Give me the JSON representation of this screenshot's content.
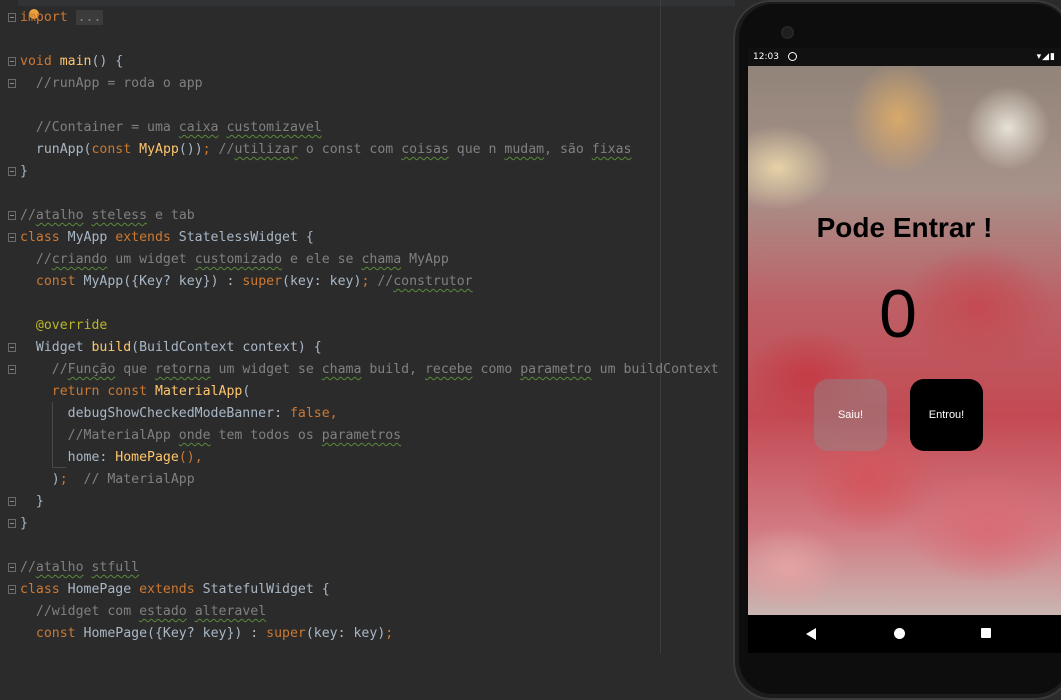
{
  "editor": {
    "lines": [
      {
        "parts": [
          {
            "t": "import",
            "c": "k"
          },
          {
            "t": " "
          },
          {
            "t": "...",
            "c": "dots"
          }
        ]
      },
      {
        "parts": []
      },
      {
        "parts": [
          {
            "t": "void",
            "c": "k"
          },
          {
            "t": " "
          },
          {
            "t": "main",
            "c": "f"
          },
          {
            "t": "() {"
          }
        ]
      },
      {
        "parts": [
          {
            "t": "  //runApp = roda o app",
            "c": "c"
          }
        ]
      },
      {
        "parts": []
      },
      {
        "parts": [
          {
            "t": "  //Container = uma ",
            "c": "c"
          },
          {
            "t": "caixa",
            "c": "c u"
          },
          {
            "t": " ",
            "c": "c"
          },
          {
            "t": "customizavel",
            "c": "c u"
          }
        ]
      },
      {
        "parts": [
          {
            "t": "  runApp("
          },
          {
            "t": "const",
            "c": "k"
          },
          {
            "t": " "
          },
          {
            "t": "MyApp",
            "c": "f"
          },
          {
            "t": "())"
          },
          {
            "t": ";",
            "c": "k"
          },
          {
            "t": " //",
            "c": "c"
          },
          {
            "t": "utilizar",
            "c": "c u"
          },
          {
            "t": " o const com ",
            "c": "c"
          },
          {
            "t": "coisas",
            "c": "c u"
          },
          {
            "t": " que n ",
            "c": "c"
          },
          {
            "t": "mudam",
            "c": "c u"
          },
          {
            "t": ", são ",
            "c": "c"
          },
          {
            "t": "fixas",
            "c": "c u"
          }
        ]
      },
      {
        "parts": [
          {
            "t": "}"
          }
        ]
      },
      {
        "parts": []
      },
      {
        "parts": [
          {
            "t": "//",
            "c": "c"
          },
          {
            "t": "atalho",
            "c": "c u"
          },
          {
            "t": " ",
            "c": "c"
          },
          {
            "t": "steless",
            "c": "c u"
          },
          {
            "t": " e tab",
            "c": "c"
          }
        ]
      },
      {
        "parts": [
          {
            "t": "class",
            "c": "k"
          },
          {
            "t": " MyApp "
          },
          {
            "t": "extends",
            "c": "k"
          },
          {
            "t": " StatelessWidget {"
          }
        ]
      },
      {
        "parts": [
          {
            "t": "  //",
            "c": "c"
          },
          {
            "t": "criando",
            "c": "c u"
          },
          {
            "t": " um widget ",
            "c": "c"
          },
          {
            "t": "customizado",
            "c": "c u"
          },
          {
            "t": " e ele se ",
            "c": "c"
          },
          {
            "t": "chama",
            "c": "c u"
          },
          {
            "t": " MyApp",
            "c": "c"
          }
        ]
      },
      {
        "parts": [
          {
            "t": "  "
          },
          {
            "t": "const",
            "c": "k"
          },
          {
            "t": " MyApp({Key? key}) : "
          },
          {
            "t": "super",
            "c": "k"
          },
          {
            "t": "(key: key)"
          },
          {
            "t": ";",
            "c": "k"
          },
          {
            "t": " //",
            "c": "c"
          },
          {
            "t": "construtor",
            "c": "c u"
          }
        ]
      },
      {
        "parts": []
      },
      {
        "parts": [
          {
            "t": "  "
          },
          {
            "t": "@override",
            "c": "a"
          }
        ]
      },
      {
        "parts": [
          {
            "t": "  Widget "
          },
          {
            "t": "build",
            "c": "f"
          },
          {
            "t": "(BuildContext context) {"
          }
        ]
      },
      {
        "parts": [
          {
            "t": "    //",
            "c": "c"
          },
          {
            "t": "Função",
            "c": "c u"
          },
          {
            "t": " que ",
            "c": "c"
          },
          {
            "t": "retorna",
            "c": "c u"
          },
          {
            "t": " um widget se ",
            "c": "c"
          },
          {
            "t": "chama",
            "c": "c u"
          },
          {
            "t": " build, ",
            "c": "c"
          },
          {
            "t": "recebe",
            "c": "c u"
          },
          {
            "t": " como ",
            "c": "c"
          },
          {
            "t": "parametro",
            "c": "c u"
          },
          {
            "t": " um buildContext",
            "c": "c"
          }
        ]
      },
      {
        "parts": [
          {
            "t": "    "
          },
          {
            "t": "return",
            "c": "k"
          },
          {
            "t": " "
          },
          {
            "t": "const",
            "c": "k"
          },
          {
            "t": " "
          },
          {
            "t": "MaterialApp",
            "c": "f"
          },
          {
            "t": "("
          }
        ]
      },
      {
        "parts": [
          {
            "t": "      debugShowCheckedModeBanner: "
          },
          {
            "t": "false,",
            "c": "k"
          }
        ]
      },
      {
        "parts": [
          {
            "t": "      //MaterialApp ",
            "c": "c"
          },
          {
            "t": "onde",
            "c": "c u"
          },
          {
            "t": " tem todos os ",
            "c": "c"
          },
          {
            "t": "parametros",
            "c": "c u"
          }
        ]
      },
      {
        "parts": [
          {
            "t": "      home: "
          },
          {
            "t": "HomePage",
            "c": "f"
          },
          {
            "t": "(),",
            "c": "k"
          }
        ]
      },
      {
        "parts": [
          {
            "t": "    )"
          },
          {
            "t": ";",
            "c": "k"
          },
          {
            "t": "  // MaterialApp",
            "c": "c"
          }
        ]
      },
      {
        "parts": [
          {
            "t": "  }"
          }
        ]
      },
      {
        "parts": [
          {
            "t": "}"
          }
        ]
      },
      {
        "parts": []
      },
      {
        "parts": [
          {
            "t": "//",
            "c": "c"
          },
          {
            "t": "atalho",
            "c": "c u"
          },
          {
            "t": " ",
            "c": "c"
          },
          {
            "t": "stfull",
            "c": "c u"
          }
        ]
      },
      {
        "parts": [
          {
            "t": "class",
            "c": "k"
          },
          {
            "t": " HomePage "
          },
          {
            "t": "extends",
            "c": "k"
          },
          {
            "t": " StatefulWidget {"
          }
        ]
      },
      {
        "parts": [
          {
            "t": "  //widget com ",
            "c": "c"
          },
          {
            "t": "estado",
            "c": "c u"
          },
          {
            "t": " ",
            "c": "c"
          },
          {
            "t": "alteravel",
            "c": "c u"
          }
        ]
      },
      {
        "parts": [
          {
            "t": "  "
          },
          {
            "t": "const",
            "c": "k"
          },
          {
            "t": " HomePage({Key? key}) : "
          },
          {
            "t": "super",
            "c": "k"
          },
          {
            "t": "(key: key)"
          },
          {
            "t": ";",
            "c": "k"
          }
        ]
      }
    ]
  },
  "phone": {
    "status": {
      "time": "12:03",
      "icons": "▾◢▮"
    },
    "title": "Pode Entrar !",
    "counter": "0",
    "buttons": {
      "saiu": "Saiu!",
      "entrou": "Entrou!"
    }
  }
}
